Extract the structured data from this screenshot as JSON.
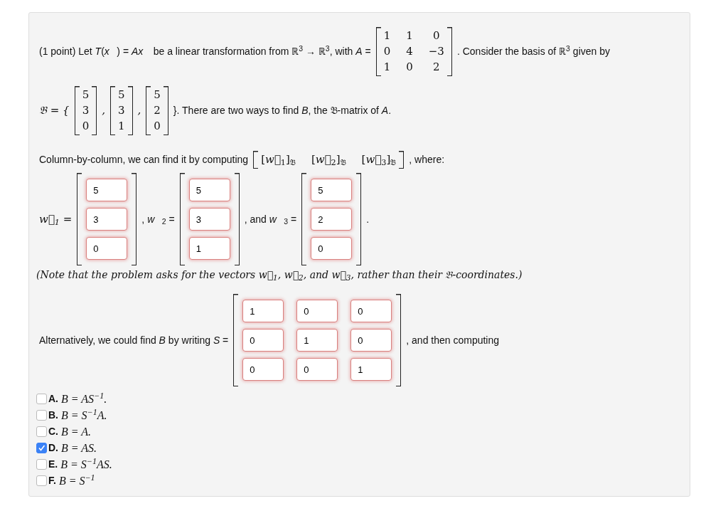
{
  "problem": {
    "lines": [
      {
        "segments": [
          {
            "kind": "text",
            "text": "(1 point) Let *T*(*x⃗*) = *Ax⃗* be a linear transformation from ℝ$^{3}$ → ℝ$^{3}$, with *A* ="
          },
          {
            "kind": "matrix",
            "rows": [
              [
                "1",
                "1",
                "0"
              ],
              [
                "0",
                "4",
                "−3"
              ],
              [
                "1",
                "0",
                "2"
              ]
            ]
          },
          {
            "kind": "text",
            "text": ". Consider the basis of ℝ$^{3}$ given by"
          }
        ]
      },
      {
        "segments": [
          {
            "kind": "math",
            "text": "𝔅 = {"
          },
          {
            "kind": "matrix",
            "rows": [
              [
                "5"
              ],
              [
                "3"
              ],
              [
                "0"
              ]
            ]
          },
          {
            "kind": "math",
            "text": ","
          },
          {
            "kind": "matrix",
            "rows": [
              [
                "5"
              ],
              [
                "3"
              ],
              [
                "1"
              ]
            ]
          },
          {
            "kind": "math",
            "text": ","
          },
          {
            "kind": "matrix",
            "rows": [
              [
                "5"
              ],
              [
                "2"
              ],
              [
                "0"
              ]
            ]
          },
          {
            "kind": "text",
            "text": "}. There are two ways to find *B*, the 𝔅-matrix of *A*."
          }
        ]
      },
      {
        "segments": [
          {
            "kind": "text",
            "text": "Column-by-column, we can find it by computing"
          },
          {
            "kind": "matrix",
            "rows": [
              [
                "[*w⃗*$_{1}$]$_{𝔅}$",
                "[*w⃗*$_{2}$]$_{𝔅}$",
                "[*w⃗*$_{3}$]$_{𝔅}$"
              ]
            ]
          },
          {
            "kind": "text",
            "text": ", where:"
          }
        ]
      },
      {
        "segments": [
          {
            "kind": "math",
            "text": "w⃗$_{1}$ ="
          },
          {
            "kind": "fields",
            "rows": [
              [
                "5"
              ],
              [
                "3"
              ],
              [
                "0"
              ]
            ]
          },
          {
            "kind": "text",
            "text": ", *w⃗*$_{2}$ ="
          },
          {
            "kind": "fields",
            "rows": [
              [
                "5"
              ],
              [
                "3"
              ],
              [
                "1"
              ]
            ]
          },
          {
            "kind": "text",
            "text": ", and *w⃗*$_{3}$ ="
          },
          {
            "kind": "fields",
            "rows": [
              [
                "5"
              ],
              [
                "2"
              ],
              [
                "0"
              ]
            ]
          },
          {
            "kind": "text",
            "text": "."
          }
        ]
      },
      {
        "segments": [
          {
            "kind": "note",
            "text": "(Note that the problem asks for the vectors w⃗$_{1}$, w⃗$_{2}$, and w⃗$_{3}$, rather than their 𝔅-coordinates.)"
          }
        ]
      },
      {
        "segments": [
          {
            "kind": "text",
            "text": "Alternatively, we could find *B* by writing *S* ="
          },
          {
            "kind": "fields",
            "rows": [
              [
                "1",
                "0",
                "0"
              ],
              [
                "0",
                "1",
                "0"
              ],
              [
                "0",
                "0",
                "1"
              ]
            ]
          },
          {
            "kind": "text",
            "text": ", and then computing"
          }
        ]
      }
    ],
    "choices": [
      {
        "letter": "A.",
        "formula": "*B* = *AS*$^{−1}$.",
        "checked": false
      },
      {
        "letter": "B.",
        "formula": "*B* = *S*$^{−1}$*A*.",
        "checked": false
      },
      {
        "letter": "C.",
        "formula": "*B* = *A*.",
        "checked": false
      },
      {
        "letter": "D.",
        "formula": "*B* = *AS*.",
        "checked": true
      },
      {
        "letter": "E.",
        "formula": "*B* = *S*$^{−1}$*AS*.",
        "checked": false
      },
      {
        "letter": "F.",
        "formula": "*B* = *S*$^{−1}$",
        "checked": false
      }
    ]
  }
}
